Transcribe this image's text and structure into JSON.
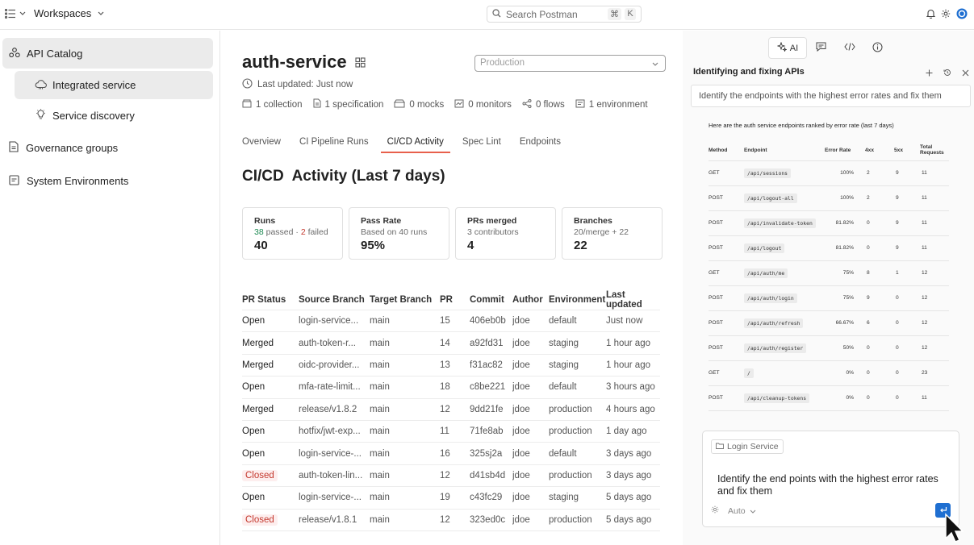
{
  "topbar": {
    "workspace_label": "Workspaces",
    "search_placeholder": "Search Postman",
    "shortcut_key1": "⌘",
    "shortcut_key2": "K"
  },
  "sidebar": {
    "items": [
      {
        "label": "API Catalog",
        "icon": "catalog-icon"
      },
      {
        "label": "Integrated service",
        "icon": "cloud-icon"
      },
      {
        "label": "Service discovery",
        "icon": "bulb-icon"
      },
      {
        "label": "Governance groups",
        "icon": "document-icon"
      },
      {
        "label": "System Environments",
        "icon": "environment-icon"
      }
    ]
  },
  "main": {
    "title": "auth-service",
    "env_placeholder": "Production",
    "last_updated": "Last updated: Just now",
    "meta": [
      "1 collection",
      "1 specification",
      "0 mocks",
      "0 monitors",
      "0 flows",
      "1 environment"
    ],
    "tabs": [
      "Overview",
      "CI Pipeline Runs",
      "CI/CD Activity",
      "Spec Lint",
      "Endpoints"
    ],
    "active_tab": "CI/CD Activity",
    "section_title": "CI/CD  Activity (Last 7 days)",
    "cards": [
      {
        "label": "Runs",
        "passed": "38",
        "passed_text": "passed · ",
        "failed": "2",
        "failed_text": "failed",
        "value": "40"
      },
      {
        "label": "Pass Rate",
        "sub": "Based on 40 runs",
        "value": "95%"
      },
      {
        "label": "PRs merged",
        "sub": "3 contributors",
        "value": "4"
      },
      {
        "label": "Branches",
        "sub": "20/merge + 22",
        "value": "22"
      }
    ],
    "table": {
      "headers": [
        "PR Status",
        "Source Branch",
        "Target Branch",
        "PR",
        "Commit",
        "Author",
        "Environment",
        "Last updated"
      ],
      "rows": [
        [
          "Open",
          "login-service...",
          "main",
          "15",
          "406eb0b",
          "jdoe",
          "default",
          "Just now"
        ],
        [
          "Merged",
          "auth-token-r...",
          "main",
          "14",
          "a92fd31",
          "jdoe",
          "staging",
          "1 hour ago"
        ],
        [
          "Merged",
          "oidc-provider...",
          "main",
          "13",
          "f31ac82",
          "jdoe",
          "staging",
          "1 hour ago"
        ],
        [
          "Open",
          "mfa-rate-limit...",
          "main",
          "18",
          "c8be221",
          "jdoe",
          "default",
          "3 hours ago"
        ],
        [
          "Merged",
          "release/v1.8.2",
          "main",
          "12",
          "9dd21fe",
          "jdoe",
          "production",
          "4 hours ago"
        ],
        [
          "Open",
          "hotfix/jwt-exp...",
          "main",
          "11",
          "71fe8ab",
          "jdoe",
          "production",
          "1 day ago"
        ],
        [
          "Open",
          "login-service-...",
          "main",
          "16",
          "325sj2a",
          "jdoe",
          "default",
          "3 days ago"
        ],
        [
          "Closed",
          "auth-token-lin...",
          "main",
          "12",
          "d41sb4d",
          "jdoe",
          "production",
          "3 days ago"
        ],
        [
          "Open",
          "login-service-...",
          "main",
          "19",
          "c43fc29",
          "jdoe",
          "staging",
          "5 days ago"
        ],
        [
          "Closed",
          "release/v1.8.1",
          "main",
          "12",
          "323ed0c",
          "jdoe",
          "production",
          "5 days ago"
        ]
      ]
    }
  },
  "panel": {
    "ai_tab": "AI",
    "title": "Identifying and fixing APIs",
    "prompt": "Identify the endpoints with the highest error rates and fix them",
    "response_heading": "Here are the auth service endpoints ranked by error rate (last 7 days)",
    "endpoint_headers": [
      "Method",
      "Endpoint",
      "Error Rate",
      "4xx",
      "5xx",
      "Total Requests"
    ],
    "endpoints": [
      [
        "GET",
        "/api/sessions",
        "100%",
        "2",
        "9",
        "11"
      ],
      [
        "POST",
        "/api/logout-all",
        "100%",
        "2",
        "9",
        "11"
      ],
      [
        "POST",
        "/api/invalidate-token",
        "81.82%",
        "0",
        "9",
        "11"
      ],
      [
        "POST",
        "/api/logout",
        "81.82%",
        "0",
        "9",
        "11"
      ],
      [
        "GET",
        "/api/auth/me",
        "75%",
        "8",
        "1",
        "12"
      ],
      [
        "POST",
        "/api/auth/login",
        "75%",
        "9",
        "0",
        "12"
      ],
      [
        "POST",
        "/api/auth/refresh",
        "66.67%",
        "6",
        "0",
        "12"
      ],
      [
        "POST",
        "/api/auth/register",
        "50%",
        "0",
        "0",
        "12"
      ],
      [
        "GET",
        "/",
        "0%",
        "0",
        "0",
        "23"
      ],
      [
        "POST",
        "/api/cleanup-tokens",
        "0%",
        "0",
        "0",
        "11"
      ]
    ],
    "composer_chip": "Login Service",
    "composer_text": "Identify the end points with the highest error rates and fix them",
    "model_label": "Auto"
  },
  "colors": {
    "accent": "#e8604c",
    "send": "#1f6fd1",
    "closed": "#c4382d",
    "passed": "#1e8a53"
  }
}
